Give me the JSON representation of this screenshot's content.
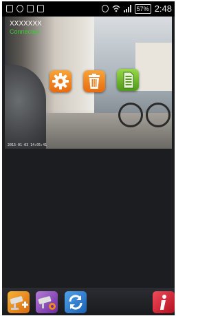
{
  "status_bar": {
    "battery": "57%",
    "time": "2:48"
  },
  "camera": {
    "name": "XXXXXXX",
    "status": "Connected",
    "timestamp": "2015-01-03 14:05:41"
  },
  "icons": {
    "settings": "gear-icon",
    "delete": "trash-icon",
    "storage": "sd-card-icon",
    "add_camera": "add-camera-icon",
    "camera_settings": "camera-settings-icon",
    "refresh": "refresh-icon",
    "info": "info-icon"
  },
  "colors": {
    "status_connected": "#38d02f",
    "orange_button": "#e86b0e",
    "green_button": "#4d9a16",
    "info_button": "#b3101f",
    "background": "#1b1d21"
  }
}
